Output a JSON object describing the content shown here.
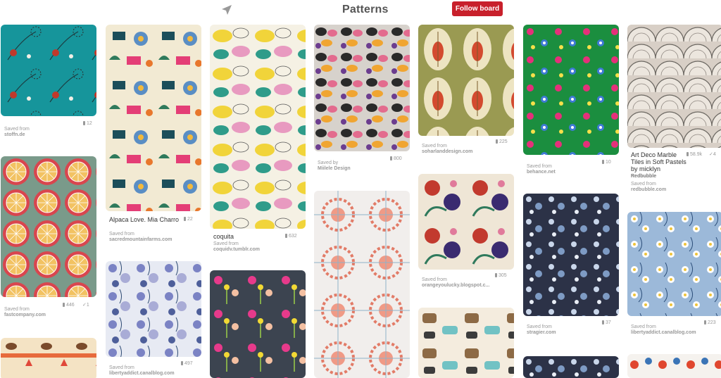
{
  "board": {
    "title": "Patterns",
    "follow_label": "Follow board"
  },
  "colors": {
    "brand_red": "#c8202b"
  },
  "pins": {
    "p1": {
      "saved": "Saved from",
      "source": "stoffn.de",
      "repins": "12"
    },
    "p2": {
      "saved": "Saved from",
      "source": "fastcompany.com",
      "repins": "446",
      "likes": "1"
    },
    "p4": {
      "desc": "Alpaca Love. Mia Charro",
      "saved": "Saved from",
      "source": "sacredmountainfarms.com",
      "repins": "22"
    },
    "p5": {
      "saved": "Saved from",
      "source": "libertyaddict.canalblog.com",
      "repins": "497"
    },
    "p6": {
      "desc": "coquita",
      "saved": "Saved from",
      "source": "coquidv.tumblr.com",
      "repins": "632"
    },
    "p8": {
      "saved": "Saved by",
      "source": "Miilele Design",
      "repins": "800"
    },
    "p10": {
      "saved": "Saved from",
      "source": "soharlanddesign.com",
      "repins": "225"
    },
    "p11": {
      "saved": "Saved from",
      "source": "orangeyoulucky.blogspot.c...",
      "repins": "305"
    },
    "p13": {
      "saved": "Saved from",
      "source": "behance.net",
      "repins": "10"
    },
    "p14": {
      "saved": "Saved from",
      "source": "stragier.com",
      "repins": "37"
    },
    "p16": {
      "desc": "Art Deco Marble Tiles in Soft Pastels by micklyn",
      "brand": "Redbubble",
      "saved": "Saved from",
      "source": "redbubble.com",
      "repins": "58.9k",
      "likes": "4"
    },
    "p17": {
      "saved": "Saved from",
      "source": "libertyaddict.canalblog.com",
      "repins": "223"
    }
  }
}
